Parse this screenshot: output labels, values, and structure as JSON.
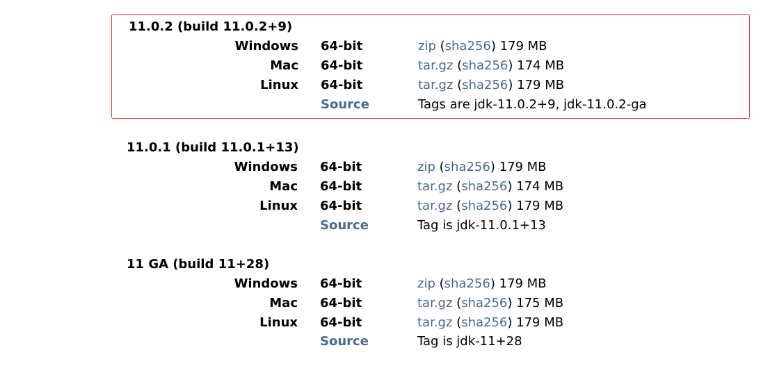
{
  "colors": {
    "link": "#4a6a8a",
    "highlight_border": "#e04040"
  },
  "releases": [
    {
      "highlight": true,
      "title": "11.0.2 (build 11.0.2+9)",
      "builds": [
        {
          "os": "Windows",
          "arch": "64-bit",
          "format": "zip",
          "sha_label": "sha256",
          "size": "179 MB"
        },
        {
          "os": "Mac",
          "arch": "64-bit",
          "format": "tar.gz",
          "sha_label": "sha256",
          "size": "174 MB"
        },
        {
          "os": "Linux",
          "arch": "64-bit",
          "format": "tar.gz",
          "sha_label": "sha256",
          "size": "179 MB"
        }
      ],
      "source_label": "Source",
      "source_text": "Tags are jdk-11.0.2+9, jdk-11.0.2-ga"
    },
    {
      "highlight": false,
      "title": "11.0.1 (build 11.0.1+13)",
      "builds": [
        {
          "os": "Windows",
          "arch": "64-bit",
          "format": "zip",
          "sha_label": "sha256",
          "size": "179 MB"
        },
        {
          "os": "Mac",
          "arch": "64-bit",
          "format": "tar.gz",
          "sha_label": "sha256",
          "size": "174 MB"
        },
        {
          "os": "Linux",
          "arch": "64-bit",
          "format": "tar.gz",
          "sha_label": "sha256",
          "size": "179 MB"
        }
      ],
      "source_label": "Source",
      "source_text": "Tag is jdk-11.0.1+13"
    },
    {
      "highlight": false,
      "title": "11 GA (build 11+28)",
      "builds": [
        {
          "os": "Windows",
          "arch": "64-bit",
          "format": "zip",
          "sha_label": "sha256",
          "size": "179 MB"
        },
        {
          "os": "Mac",
          "arch": "64-bit",
          "format": "tar.gz",
          "sha_label": "sha256",
          "size": "175 MB"
        },
        {
          "os": "Linux",
          "arch": "64-bit",
          "format": "tar.gz",
          "sha_label": "sha256",
          "size": "179 MB"
        }
      ],
      "source_label": "Source",
      "source_text": "Tag is jdk-11+28"
    }
  ]
}
